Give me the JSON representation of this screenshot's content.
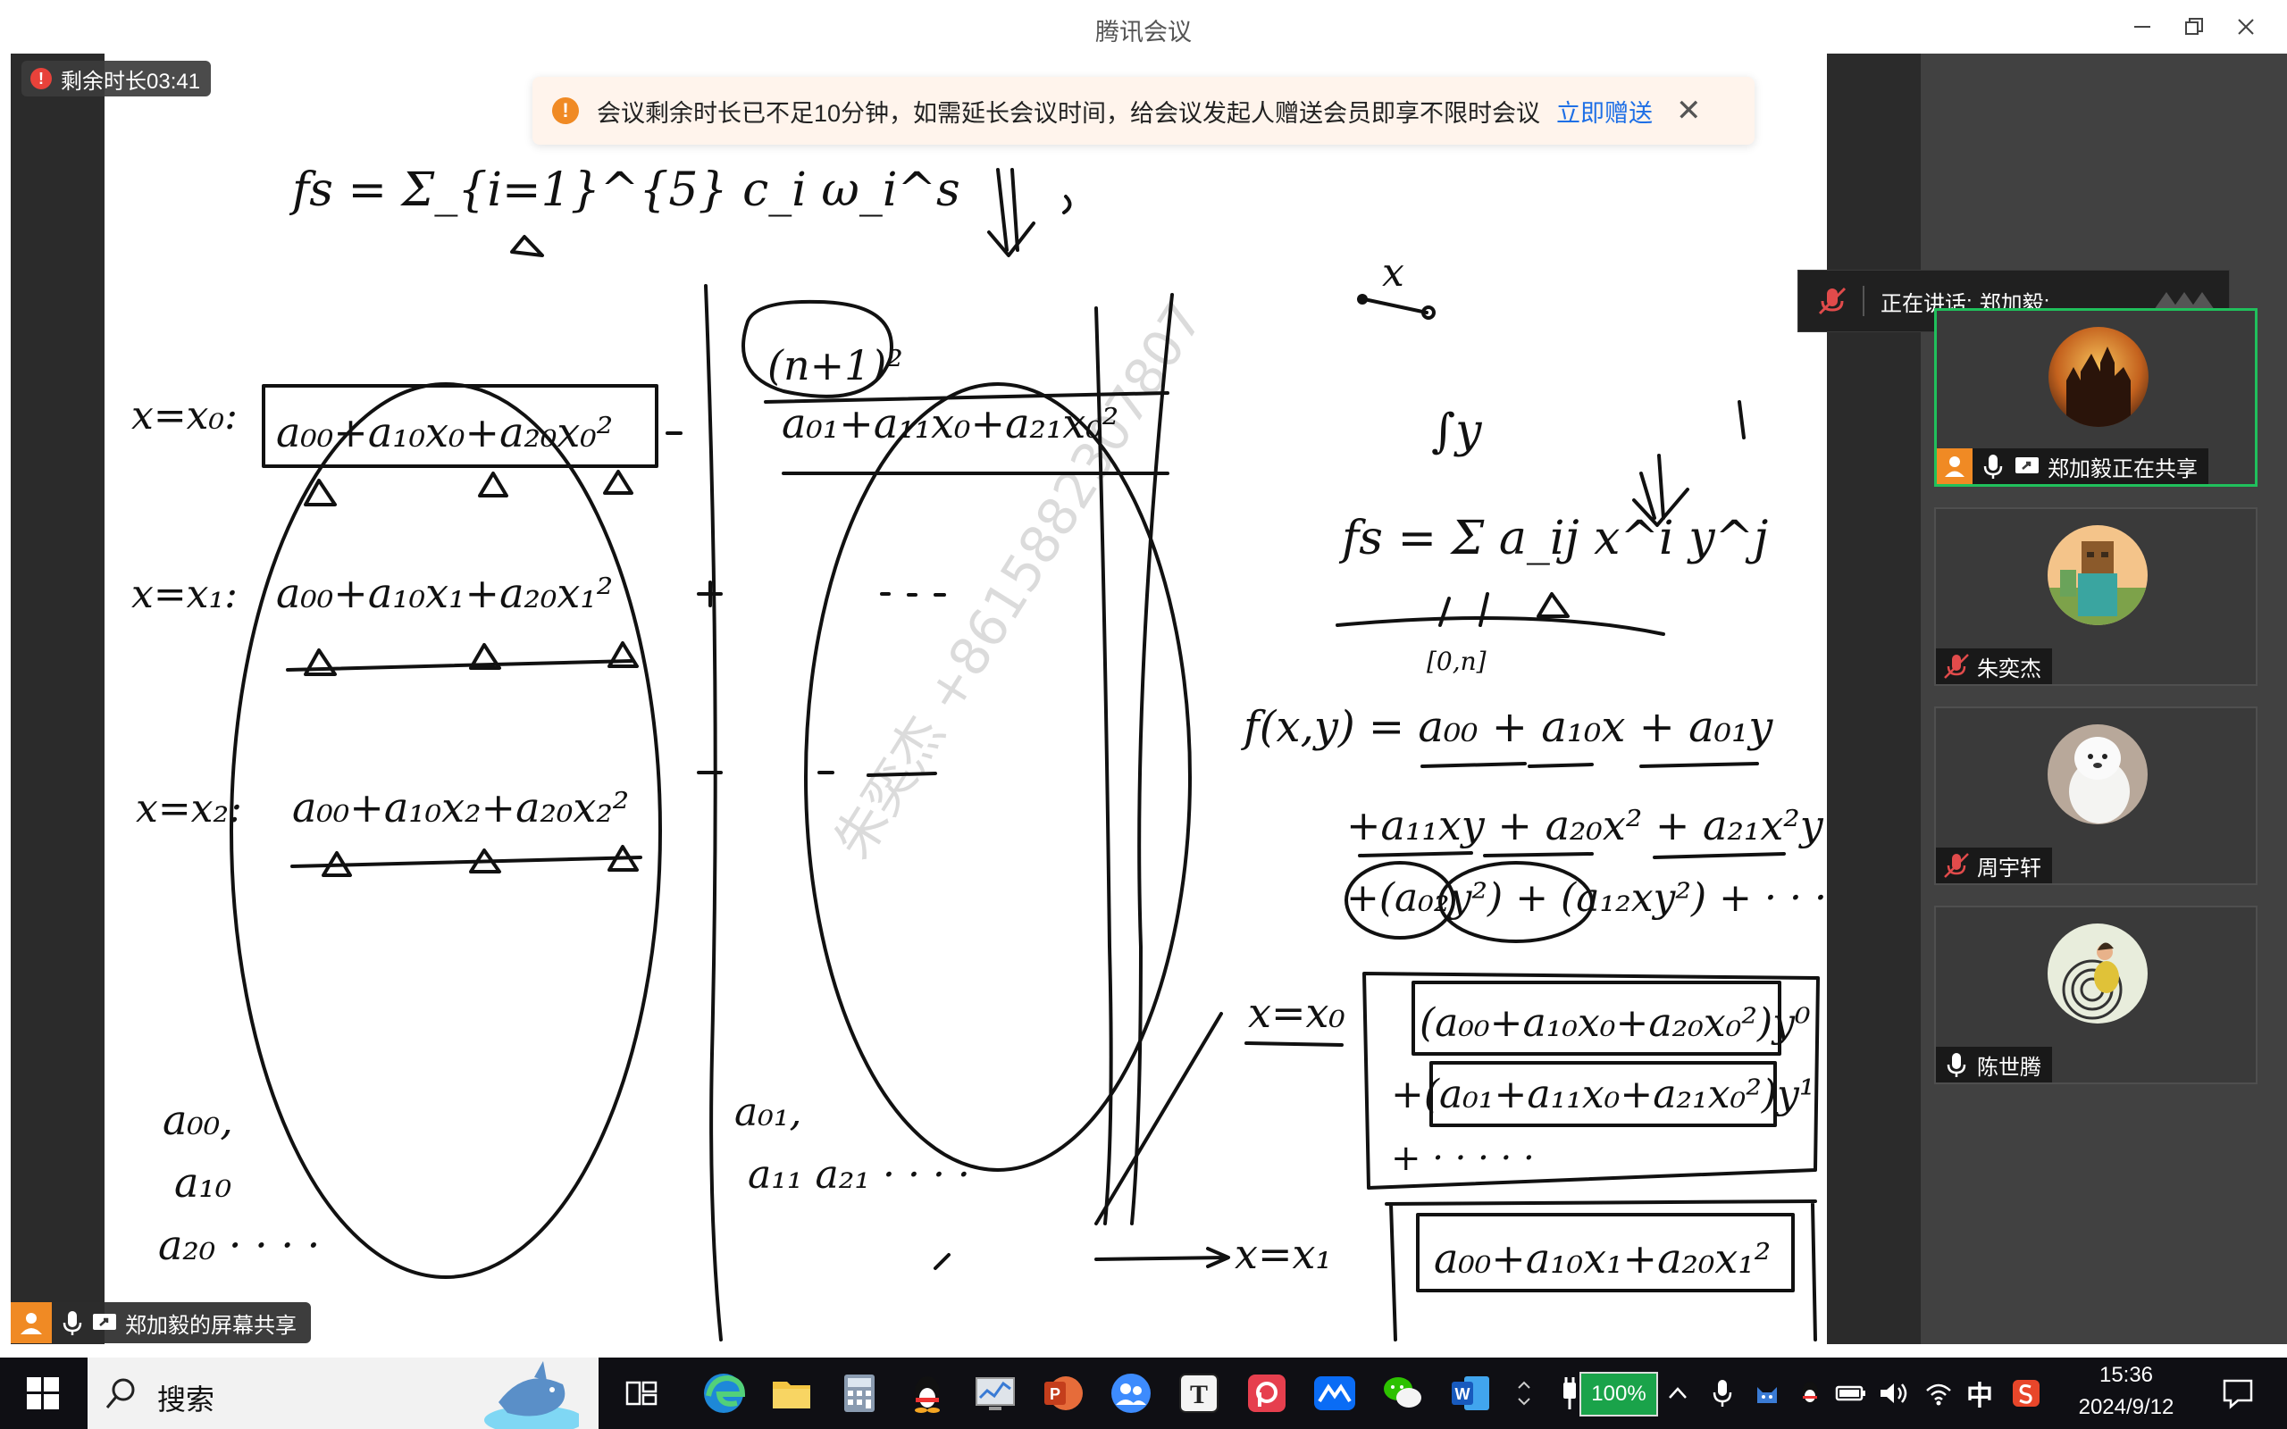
{
  "window": {
    "title": "腾讯会议"
  },
  "timer": {
    "label": "剩余时长03:41"
  },
  "notice": {
    "message": "会议剩余时长已不足10分钟，如需延长会议时间，给会议发起人赠送会员即享不限时会议",
    "action_label": "立即赠送"
  },
  "speaking": {
    "label": "正在讲话:",
    "name": "郑加毅;"
  },
  "participants": [
    {
      "name": "郑加毅正在共享",
      "mic": "on",
      "sharing": true,
      "active": true
    },
    {
      "name": "朱奕杰",
      "mic": "muted"
    },
    {
      "name": "周宇轩",
      "mic": "muted"
    },
    {
      "name": "陈世腾",
      "mic": "on"
    }
  ],
  "share_label": "郑加毅的屏幕共享",
  "watermark": "朱奕杰 +8615882307807",
  "whiteboard": {
    "eq1": "fs = Σ_{i=1}^{5} c_i ω_i^s",
    "circle": "(n+1)²",
    "row0_label": "x=x₀:",
    "row0_a": "a₀₀+a₁₀x₀+a₂₀x₀²",
    "row0_b": "a₀₁+a₁₁x₀+a₂₁x₀²",
    "row1_label": "x=x₁:",
    "row1_a": "a₀₀+a₁₀x₁+a₂₀x₁²",
    "row2_label": "x=x₂:",
    "row2_a": "a₀₀+a₁₀x₂+a₂₀x₂²",
    "list_a": [
      "a₀₀,",
      "a₁₀",
      "a₂₀ · · · ·"
    ],
    "list_b": [
      "a₀₁,",
      "a₁₁  a₂₁  · · · ·"
    ],
    "x_label": "x",
    "y_label": "∫y",
    "eq2": "fs = Σ a_ij x^i y^j",
    "range": "[0,n]",
    "fxy1": "f(x,y) = a₀₀ + a₁₀x + a₀₁y",
    "fxy2": "+a₁₁xy + a₂₀x² + a₂₁x²y",
    "fxy3": "+(a₀₂y²) + (a₁₂xy²) + · · · · ·",
    "x0_label": "x=x₀",
    "box1": "(a₀₀+a₁₀x₀+a₂₀x₀²)y⁰",
    "box2": "+(a₀₁+a₁₁x₀+a₂₁x₀²)y¹",
    "box3": "+ · · · · ·",
    "x1_label": "x=x₁",
    "box4": "a₀₀+a₁₀x₁+a₂₀x₁²"
  },
  "taskbar": {
    "search_label": "搜索",
    "battery": "100%",
    "ime": "中",
    "time": "15:36",
    "date": "2024/9/12"
  }
}
